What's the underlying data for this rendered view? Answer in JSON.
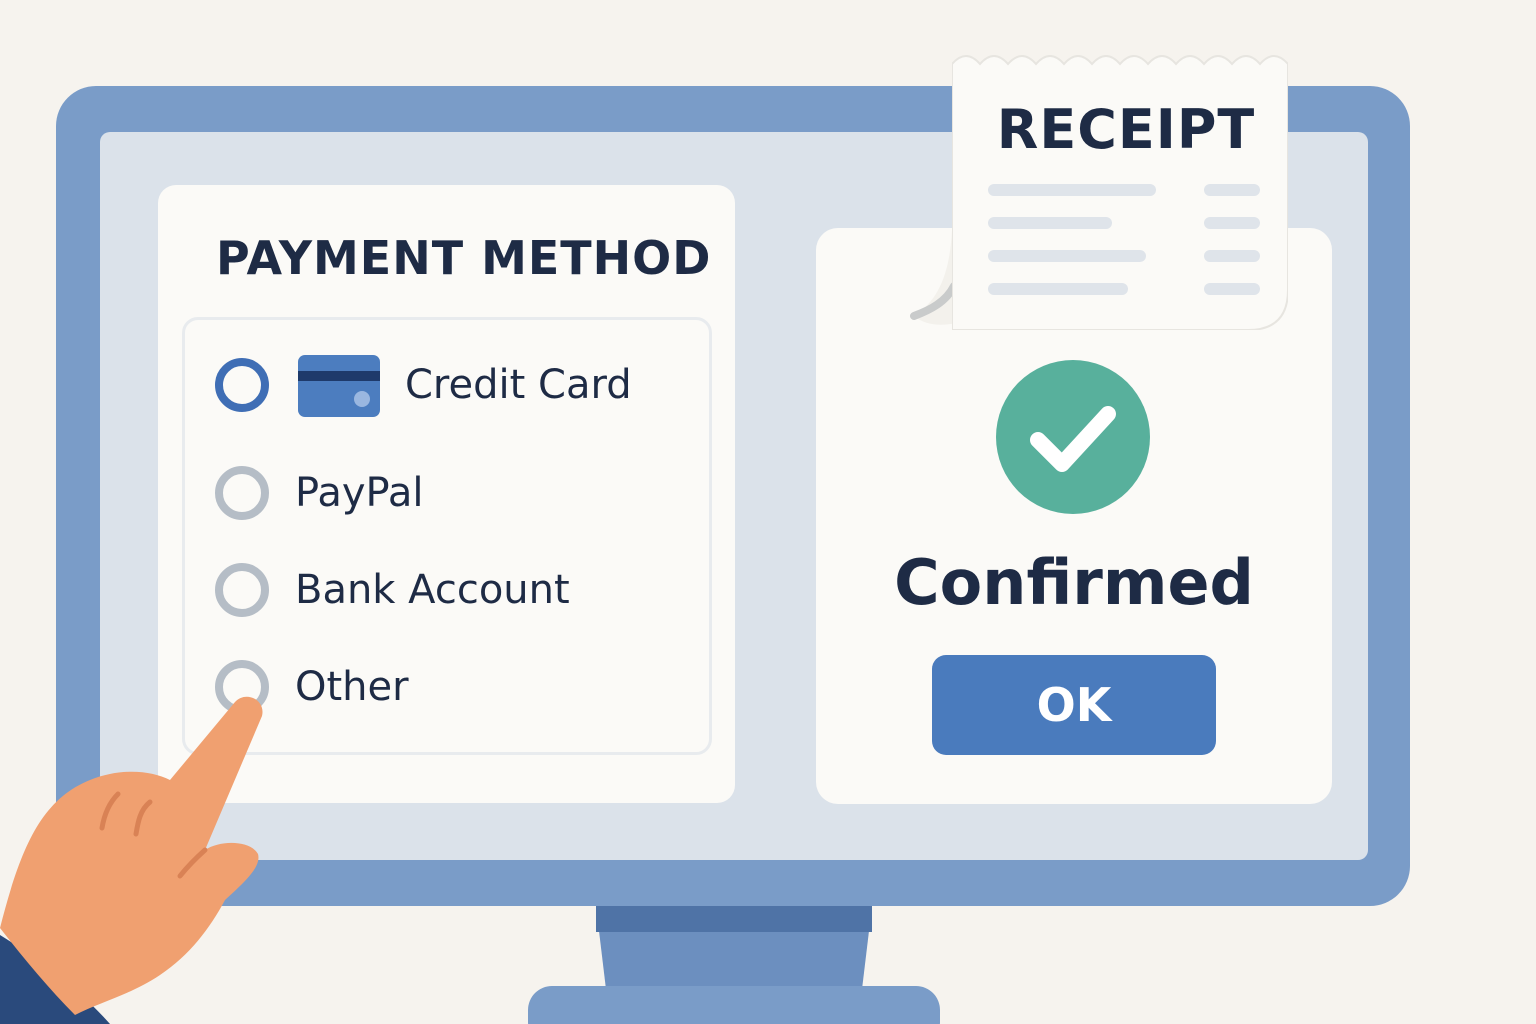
{
  "payment": {
    "title": "PAYMENT METHOD",
    "options": [
      {
        "label": "Credit Card",
        "selected": true,
        "icon": "credit-card-icon"
      },
      {
        "label": "PayPal",
        "selected": false
      },
      {
        "label": "Bank Account",
        "selected": false
      },
      {
        "label": "Other",
        "selected": false
      }
    ]
  },
  "receipt": {
    "title": "RECEIPT"
  },
  "confirmation": {
    "status": "Confirmed",
    "icon": "checkmark-icon",
    "ok_label": "OK"
  },
  "colors": {
    "accent": "#4a7bbd",
    "success": "#58b09c",
    "text": "#1e2b45",
    "monitor": "#7a9cc8"
  }
}
